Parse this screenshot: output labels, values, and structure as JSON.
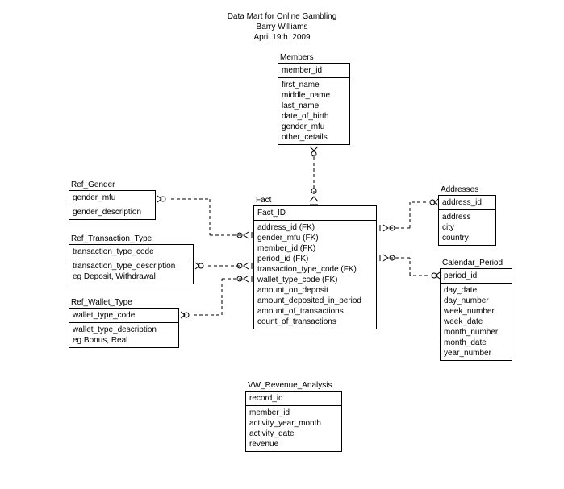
{
  "header": {
    "title": "Data Mart for Online Gambling",
    "author": "Barry Williams",
    "date": "April 19th. 2009"
  },
  "entities": {
    "members": {
      "title": "Members",
      "pk": "member_id",
      "attrs": [
        "first_name",
        "middle_name",
        "last_name",
        "date_of_birth",
        "gender_mfu",
        "other_cetails"
      ]
    },
    "refGender": {
      "title": "Ref_Gender",
      "pk": "gender_mfu",
      "attrs": [
        "gender_description"
      ]
    },
    "fact": {
      "title": "Fact",
      "pk": "Fact_ID",
      "attrs": [
        "address_id (FK)",
        "gender_mfu (FK)",
        "member_id (FK)",
        "period_id (FK)",
        "transaction_type_code (FK)",
        "wallet_type_code (FK)",
        "amount_on_deposit",
        "amount_deposited_in_period",
        "amount_of_transactions",
        "count_of_transactions"
      ]
    },
    "addresses": {
      "title": "Addresses",
      "pk": "address_id",
      "attrs": [
        "address",
        "city",
        "country"
      ]
    },
    "refTransactionType": {
      "title": "Ref_Transaction_Type",
      "pk": "transaction_type_code",
      "attrs": [
        "transaction_type_description",
        "eg Deposit, Withdrawal"
      ]
    },
    "calendarPeriod": {
      "title": "Calendar_Period",
      "pk": "period_id",
      "attrs": [
        "day_date",
        "day_number",
        "week_number",
        "week_date",
        "month_number",
        "month_date",
        "year_number"
      ]
    },
    "refWalletType": {
      "title": "Ref_Wallet_Type",
      "pk": "wallet_type_code",
      "attrs": [
        "wallet_type_description",
        "eg Bonus, Real"
      ]
    },
    "vwRevenue": {
      "title": "VW_Revenue_Analysis",
      "pk": "record_id",
      "attrs": [
        "member_id",
        "activity_year_month",
        "activity_date",
        "revenue"
      ]
    }
  },
  "chart_data": {
    "type": "table",
    "diagram_type": "entity-relationship",
    "title": "Data Mart for Online Gambling",
    "author": "Barry Williams",
    "date": "April 19th. 2009",
    "entities": [
      {
        "name": "Members",
        "pk": [
          "member_id"
        ],
        "attrs": [
          "first_name",
          "middle_name",
          "last_name",
          "date_of_birth",
          "gender_mfu",
          "other_cetails"
        ]
      },
      {
        "name": "Ref_Gender",
        "pk": [
          "gender_mfu"
        ],
        "attrs": [
          "gender_description"
        ]
      },
      {
        "name": "Fact",
        "pk": [
          "Fact_ID"
        ],
        "attrs": [
          "address_id (FK)",
          "gender_mfu (FK)",
          "member_id (FK)",
          "period_id (FK)",
          "transaction_type_code (FK)",
          "wallet_type_code (FK)",
          "amount_on_deposit",
          "amount_deposited_in_period",
          "amount_of_transactions",
          "count_of_transactions"
        ]
      },
      {
        "name": "Addresses",
        "pk": [
          "address_id"
        ],
        "attrs": [
          "address",
          "city",
          "country"
        ]
      },
      {
        "name": "Ref_Transaction_Type",
        "pk": [
          "transaction_type_code"
        ],
        "attrs": [
          "transaction_type_description",
          "eg Deposit, Withdrawal"
        ]
      },
      {
        "name": "Calendar_Period",
        "pk": [
          "period_id"
        ],
        "attrs": [
          "day_date",
          "day_number",
          "week_number",
          "week_date",
          "month_number",
          "month_date",
          "year_number"
        ]
      },
      {
        "name": "Ref_Wallet_Type",
        "pk": [
          "wallet_type_code"
        ],
        "attrs": [
          "wallet_type_description",
          "eg Bonus, Real"
        ]
      },
      {
        "name": "VW_Revenue_Analysis",
        "pk": [
          "record_id"
        ],
        "attrs": [
          "member_id",
          "activity_year_month",
          "activity_date",
          "revenue"
        ]
      }
    ],
    "relationships": [
      {
        "from": "Members",
        "to": "Fact",
        "from_card": "one-optional",
        "to_card": "many-optional",
        "identifying": false
      },
      {
        "from": "Ref_Gender",
        "to": "Fact",
        "from_card": "one-optional",
        "to_card": "many-optional",
        "identifying": false
      },
      {
        "from": "Ref_Transaction_Type",
        "to": "Fact",
        "from_card": "one-optional",
        "to_card": "many-optional",
        "identifying": false
      },
      {
        "from": "Ref_Wallet_Type",
        "to": "Fact",
        "from_card": "one-optional",
        "to_card": "many-optional",
        "identifying": false
      },
      {
        "from": "Addresses",
        "to": "Fact",
        "from_card": "one-optional",
        "to_card": "many-optional",
        "identifying": false
      },
      {
        "from": "Calendar_Period",
        "to": "Fact",
        "from_card": "one-optional",
        "to_card": "many-optional",
        "identifying": false
      }
    ]
  }
}
